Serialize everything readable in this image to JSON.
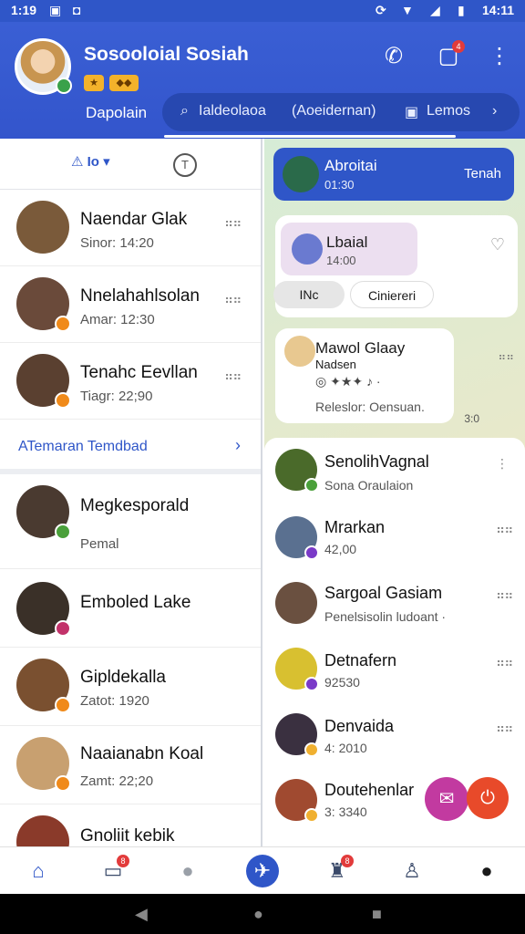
{
  "status_bar": {
    "time_left": "1:19",
    "clock": "14:11"
  },
  "header": {
    "title": "Sosooloial Sosiah",
    "subtitle": "Dapolain",
    "badge_count": "4",
    "search_segments": [
      "Ialdeolaoa",
      "(Aoeidernan)",
      "Lemos"
    ]
  },
  "filter": {
    "selected": "Io"
  },
  "left_list": [
    {
      "name": "Naendar Glak",
      "meta": "Sinor: 14:20",
      "avatar_color": "#7a5a3a",
      "status": ""
    },
    {
      "name": "Nnelahahlsolan",
      "meta": "Amar: 12:30",
      "avatar_color": "#6a4a3a",
      "status": "#f08a1a"
    },
    {
      "name": "Tenahc Eevllan",
      "meta": "Tiagr: 22;90",
      "avatar_color": "#5a4030",
      "status": "#f08a1a"
    }
  ],
  "see_more": "ATemaran Temdbad",
  "left_list2": [
    {
      "name": "Megkesporald",
      "meta": "Pemal",
      "avatar_color": "#4a3a30",
      "status": "#4aa03a"
    },
    {
      "name": "Emboled Lake",
      "meta": "",
      "avatar_color": "#3a3028",
      "status": "#c2326a"
    },
    {
      "name": "Gipldekalla",
      "meta": "Zatot: 1920",
      "avatar_color": "#7a5030",
      "status": "#f08a1a"
    },
    {
      "name": "Naaianabn Koal",
      "meta": "Zamt: 22;20",
      "avatar_color": "#c8a070",
      "status": "#f08a1a"
    },
    {
      "name": "Gnoliit kebik",
      "meta": "",
      "avatar_color": "#8a3a2a",
      "status": ""
    }
  ],
  "chat": {
    "top_name": "Abroitai",
    "top_time": "01:30",
    "top_action": "Tenah",
    "card_name": "Lbaial",
    "card_time": "14:00",
    "pill1": "INc",
    "pill2": "Ciniereri",
    "card2_name": "Mawol Glaay",
    "card2_sub": "Nadsen",
    "card2_body": "Releslor: Oensuan.",
    "card2_time": "3:0"
  },
  "right_list": [
    {
      "name": "SenolihVagnal",
      "meta": "Sona Oraulaion",
      "avatar_color": "#4a6a2a",
      "status": "#4aa03a"
    },
    {
      "name": "Mrarkan",
      "meta": "42,00",
      "avatar_color": "#5a7090",
      "status": "#7a3ac8"
    },
    {
      "name": "Sargoal Gasiam",
      "meta": "Penelsisolin ludoant ·",
      "avatar_color": "#6a5040",
      "status": ""
    },
    {
      "name": "Detnafern",
      "meta": "92530",
      "avatar_color": "#d8c030",
      "status": "#7a3ac8"
    },
    {
      "name": "Denvaida",
      "meta": "4: 2010",
      "avatar_color": "#3a3040",
      "status": "#f0b030"
    },
    {
      "name": "Doutehenlar",
      "meta": "3: 3340",
      "avatar_color": "#a04a30",
      "status": "#f0b030"
    }
  ],
  "bottom_nav": [
    {
      "name": "home",
      "glyph": "⌂",
      "badge": ""
    },
    {
      "name": "cards",
      "glyph": "▭",
      "badge": "8"
    },
    {
      "name": "circle",
      "glyph": "●",
      "badge": ""
    },
    {
      "name": "compose",
      "glyph": "✈",
      "badge": ""
    },
    {
      "name": "alerts",
      "glyph": "♜",
      "badge": "8"
    },
    {
      "name": "people",
      "glyph": "♙",
      "badge": ""
    },
    {
      "name": "profile",
      "glyph": "●",
      "badge": ""
    }
  ]
}
